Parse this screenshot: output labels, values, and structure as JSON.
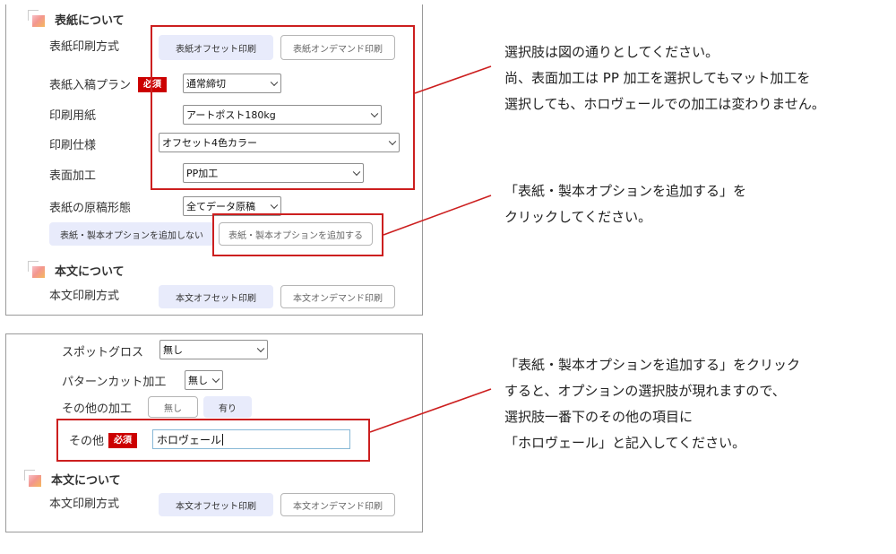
{
  "panel1": {
    "cover_heading": "表紙について",
    "print_method_label": "表紙印刷方式",
    "print_method_options": [
      "表紙オフセット印刷",
      "表紙オンデマンド印刷"
    ],
    "submission_plan_label": "表紙入稿プラン",
    "required_badge": "必須",
    "submission_plan_value": "通常締切",
    "paper_label": "印刷用紙",
    "paper_value": "アートポスト180kg",
    "spec_label": "印刷仕様",
    "spec_value": "オフセット4色カラー",
    "finish_label": "表面加工",
    "finish_value": "PP加工",
    "manuscript_label": "表紙の原稿形態",
    "manuscript_value": "全てデータ原稿",
    "no_option_button": "表紙・製本オプションを追加しない",
    "add_option_button": "表紙・製本オプションを追加する",
    "body_heading": "本文について",
    "body_print_label": "本文印刷方式",
    "body_print_options": [
      "本文オフセット印刷",
      "本文オンデマンド印刷"
    ]
  },
  "panel2": {
    "spot_gloss_label": "スポットグロス",
    "spot_gloss_value": "無し",
    "pattern_cut_label": "パターンカット加工",
    "pattern_cut_value": "無し",
    "other_finish_label": "その他の加工",
    "other_finish_options": [
      "無し",
      "有り"
    ],
    "other_label": "その他",
    "required_badge": "必須",
    "other_value": "ホロヴェール",
    "body_heading": "本文について",
    "body_print_label": "本文印刷方式",
    "body_print_options": [
      "本文オフセット印刷",
      "本文オンデマンド印刷"
    ]
  },
  "notes": {
    "note1": [
      "選択肢は図の通りとしてください。",
      "尚、表面加工は PP 加工を選択してもマット加工を",
      "選択しても、ホロヴェールでの加工は変わりません。"
    ],
    "note2": [
      "「表紙・製本オプションを追加する」を",
      "クリックしてください。"
    ],
    "note3": [
      "「表紙・製本オプションを追加する」をクリック",
      "すると、オプションの選択肢が現れますので、",
      "選択肢一番下のその他の項目に",
      "「ホロヴェール」と記入してください。"
    ]
  },
  "colors": {
    "highlight_border": "#cc1f1f",
    "selected_button": "#e8ebfb",
    "required_badge": "#cc0000"
  }
}
